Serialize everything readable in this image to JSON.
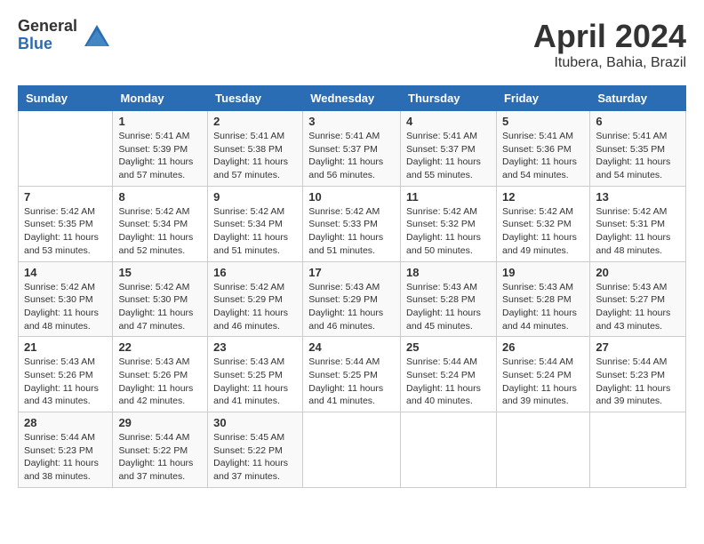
{
  "header": {
    "logo_general": "General",
    "logo_blue": "Blue",
    "title": "April 2024",
    "location": "Itubera, Bahia, Brazil"
  },
  "days_of_week": [
    "Sunday",
    "Monday",
    "Tuesday",
    "Wednesday",
    "Thursday",
    "Friday",
    "Saturday"
  ],
  "weeks": [
    [
      {
        "day": "",
        "info": ""
      },
      {
        "day": "1",
        "info": "Sunrise: 5:41 AM\nSunset: 5:39 PM\nDaylight: 11 hours\nand 57 minutes."
      },
      {
        "day": "2",
        "info": "Sunrise: 5:41 AM\nSunset: 5:38 PM\nDaylight: 11 hours\nand 57 minutes."
      },
      {
        "day": "3",
        "info": "Sunrise: 5:41 AM\nSunset: 5:37 PM\nDaylight: 11 hours\nand 56 minutes."
      },
      {
        "day": "4",
        "info": "Sunrise: 5:41 AM\nSunset: 5:37 PM\nDaylight: 11 hours\nand 55 minutes."
      },
      {
        "day": "5",
        "info": "Sunrise: 5:41 AM\nSunset: 5:36 PM\nDaylight: 11 hours\nand 54 minutes."
      },
      {
        "day": "6",
        "info": "Sunrise: 5:41 AM\nSunset: 5:35 PM\nDaylight: 11 hours\nand 54 minutes."
      }
    ],
    [
      {
        "day": "7",
        "info": "Sunrise: 5:42 AM\nSunset: 5:35 PM\nDaylight: 11 hours\nand 53 minutes."
      },
      {
        "day": "8",
        "info": "Sunrise: 5:42 AM\nSunset: 5:34 PM\nDaylight: 11 hours\nand 52 minutes."
      },
      {
        "day": "9",
        "info": "Sunrise: 5:42 AM\nSunset: 5:34 PM\nDaylight: 11 hours\nand 51 minutes."
      },
      {
        "day": "10",
        "info": "Sunrise: 5:42 AM\nSunset: 5:33 PM\nDaylight: 11 hours\nand 51 minutes."
      },
      {
        "day": "11",
        "info": "Sunrise: 5:42 AM\nSunset: 5:32 PM\nDaylight: 11 hours\nand 50 minutes."
      },
      {
        "day": "12",
        "info": "Sunrise: 5:42 AM\nSunset: 5:32 PM\nDaylight: 11 hours\nand 49 minutes."
      },
      {
        "day": "13",
        "info": "Sunrise: 5:42 AM\nSunset: 5:31 PM\nDaylight: 11 hours\nand 48 minutes."
      }
    ],
    [
      {
        "day": "14",
        "info": "Sunrise: 5:42 AM\nSunset: 5:30 PM\nDaylight: 11 hours\nand 48 minutes."
      },
      {
        "day": "15",
        "info": "Sunrise: 5:42 AM\nSunset: 5:30 PM\nDaylight: 11 hours\nand 47 minutes."
      },
      {
        "day": "16",
        "info": "Sunrise: 5:42 AM\nSunset: 5:29 PM\nDaylight: 11 hours\nand 46 minutes."
      },
      {
        "day": "17",
        "info": "Sunrise: 5:43 AM\nSunset: 5:29 PM\nDaylight: 11 hours\nand 46 minutes."
      },
      {
        "day": "18",
        "info": "Sunrise: 5:43 AM\nSunset: 5:28 PM\nDaylight: 11 hours\nand 45 minutes."
      },
      {
        "day": "19",
        "info": "Sunrise: 5:43 AM\nSunset: 5:28 PM\nDaylight: 11 hours\nand 44 minutes."
      },
      {
        "day": "20",
        "info": "Sunrise: 5:43 AM\nSunset: 5:27 PM\nDaylight: 11 hours\nand 43 minutes."
      }
    ],
    [
      {
        "day": "21",
        "info": "Sunrise: 5:43 AM\nSunset: 5:26 PM\nDaylight: 11 hours\nand 43 minutes."
      },
      {
        "day": "22",
        "info": "Sunrise: 5:43 AM\nSunset: 5:26 PM\nDaylight: 11 hours\nand 42 minutes."
      },
      {
        "day": "23",
        "info": "Sunrise: 5:43 AM\nSunset: 5:25 PM\nDaylight: 11 hours\nand 41 minutes."
      },
      {
        "day": "24",
        "info": "Sunrise: 5:44 AM\nSunset: 5:25 PM\nDaylight: 11 hours\nand 41 minutes."
      },
      {
        "day": "25",
        "info": "Sunrise: 5:44 AM\nSunset: 5:24 PM\nDaylight: 11 hours\nand 40 minutes."
      },
      {
        "day": "26",
        "info": "Sunrise: 5:44 AM\nSunset: 5:24 PM\nDaylight: 11 hours\nand 39 minutes."
      },
      {
        "day": "27",
        "info": "Sunrise: 5:44 AM\nSunset: 5:23 PM\nDaylight: 11 hours\nand 39 minutes."
      }
    ],
    [
      {
        "day": "28",
        "info": "Sunrise: 5:44 AM\nSunset: 5:23 PM\nDaylight: 11 hours\nand 38 minutes."
      },
      {
        "day": "29",
        "info": "Sunrise: 5:44 AM\nSunset: 5:22 PM\nDaylight: 11 hours\nand 37 minutes."
      },
      {
        "day": "30",
        "info": "Sunrise: 5:45 AM\nSunset: 5:22 PM\nDaylight: 11 hours\nand 37 minutes."
      },
      {
        "day": "",
        "info": ""
      },
      {
        "day": "",
        "info": ""
      },
      {
        "day": "",
        "info": ""
      },
      {
        "day": "",
        "info": ""
      }
    ]
  ]
}
